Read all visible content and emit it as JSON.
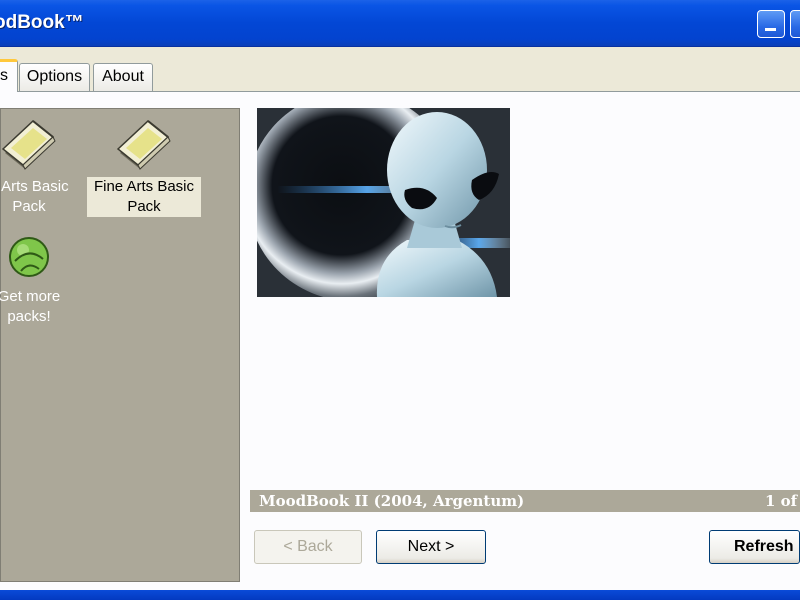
{
  "window": {
    "title": "odBook™"
  },
  "tabs": [
    {
      "label": "s",
      "active": true
    },
    {
      "label": "Options",
      "active": false
    },
    {
      "label": "About",
      "active": false
    }
  ],
  "packs": [
    {
      "label": "o Arts Basic Pack",
      "icon": "sketchbook-icon",
      "selected": false
    },
    {
      "label": "Fine Arts Basic Pack",
      "icon": "sketchbook-icon",
      "selected": true
    },
    {
      "label": "Get more packs!",
      "icon": "green-ball-icon",
      "selected": false
    }
  ],
  "viewer": {
    "caption": "MoodBook II (2004, Argentum)",
    "count": "1 of"
  },
  "buttons": {
    "back": "< Back",
    "next": "Next >",
    "refresh": "Refresh"
  },
  "colors": {
    "title_bar": "#0347d5",
    "sidebar": "#aca899",
    "selected_tab_accent": "#ffc83c"
  }
}
